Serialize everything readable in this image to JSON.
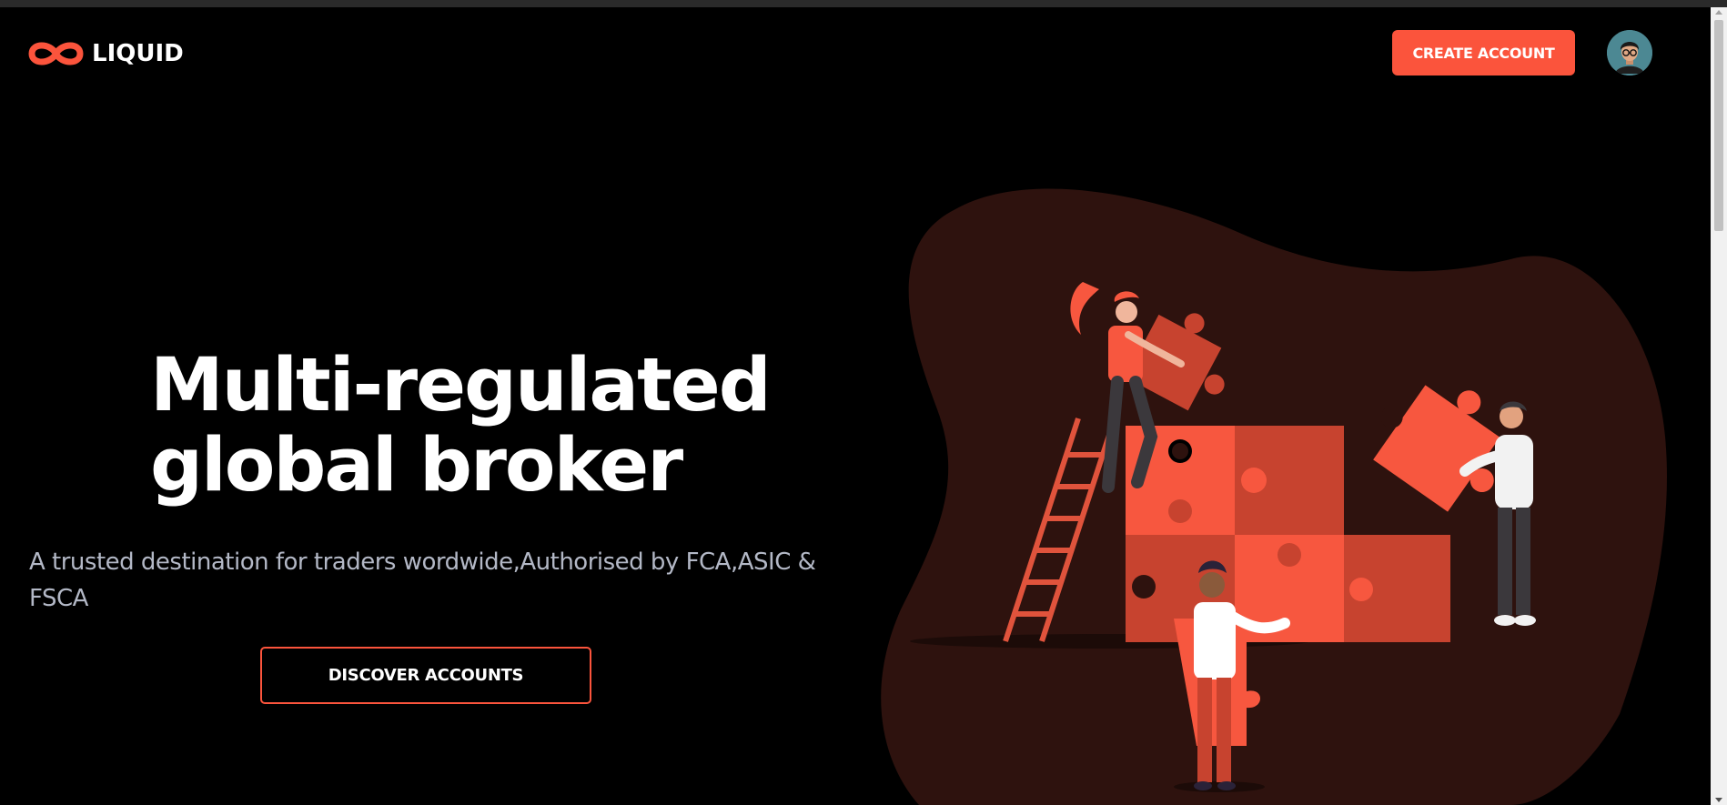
{
  "brand": {
    "name": "LIQUID",
    "logo_icon": "infinity-logo-icon",
    "accent_color": "#fb543c"
  },
  "header": {
    "create_account_label": "CREATE ACCOUNT",
    "avatar_icon": "user-avatar-icon"
  },
  "hero": {
    "title_line1": "Multi-regulated",
    "title_line2": "global broker",
    "subtitle": "A trusted destination for traders wordwide,Authorised by FCA,ASIC & FSCA",
    "discover_label": "DISCOVER ACCOUNTS",
    "illustration_icon": "team-puzzle-illustration"
  },
  "colors": {
    "background": "#000000",
    "subtitle": "#b3b8c6",
    "blob": "#2e120e"
  }
}
